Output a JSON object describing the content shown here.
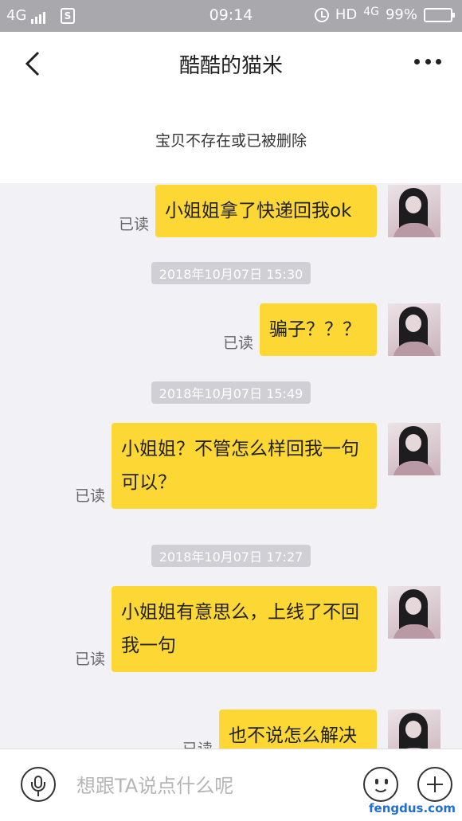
{
  "status_bar": {
    "network": "4G",
    "time": "09:14",
    "network_right": "HD",
    "network_right_gen": "4G",
    "battery_text": "99%",
    "battery_level": 0.99,
    "icons": [
      "signal-icon",
      "s-app-icon",
      "alarm-icon",
      "battery-icon"
    ]
  },
  "header": {
    "title": "酷酷的猫米",
    "back_icon": "chevron-left-icon",
    "more_icon": "more-dots-icon"
  },
  "notice": {
    "text": "宝贝不存在或已被删除"
  },
  "messages": [
    {
      "read": "已读",
      "text": "小姐姐拿了快递回我ok"
    },
    {
      "timestamp": "2018年10月07日 15:30"
    },
    {
      "read": "已读",
      "text": "骗子？？？"
    },
    {
      "timestamp": "2018年10月07日 15:49"
    },
    {
      "read": "已读",
      "text": "小姐姐？不管怎么样回我一句可以？"
    },
    {
      "timestamp": "2018年10月07日 17:27"
    },
    {
      "read": "已读",
      "text": "小姐姐有意思么，上线了不回我一句"
    },
    {
      "read": "已读",
      "text": "也不说怎么解决"
    }
  ],
  "input": {
    "placeholder": "想跟TA说点什么呢",
    "value": "",
    "icons": [
      "microphone-icon",
      "emoji-icon",
      "plus-icon"
    ]
  },
  "watermark": "fengdus.com",
  "colors": {
    "bubble": "#fdd835",
    "status_bar": "#a9a9ad",
    "chat_bg": "#f1f1f6"
  }
}
